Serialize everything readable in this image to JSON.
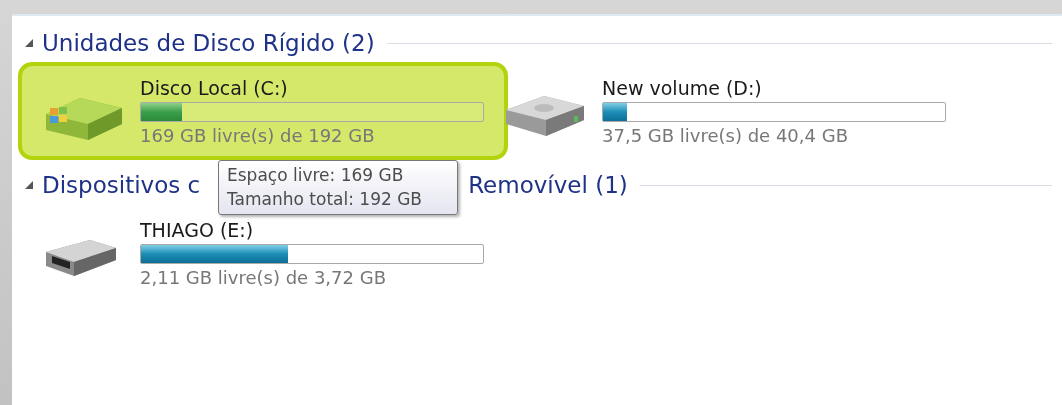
{
  "groups": [
    {
      "title": [
        "Unidades de Disco Rígido (2)"
      ],
      "expanded": true,
      "drives": [
        {
          "kind": "system",
          "name": "Disco Local (C:)",
          "level": 0.12,
          "size": "169 GB livre(s) de 192 GB",
          "selected": true,
          "tooltip": [
            "Espaço livre: 169 GB",
            "Tamanho total: 192 GB"
          ]
        },
        {
          "kind": "hdd",
          "name": "New volume (D:)",
          "level": 0.07,
          "size": "37,5 GB livre(s) de 40,4 GB",
          "selected": false
        }
      ]
    },
    {
      "title": [
        "Dispositivos c",
        "Removível (1)"
      ],
      "expanded": true,
      "drives": [
        {
          "kind": "usb",
          "name": "THIAGO (E:)",
          "level": 0.43,
          "size": "2,11 GB livre(s) de 3,72 GB",
          "selected": false
        }
      ]
    }
  ]
}
